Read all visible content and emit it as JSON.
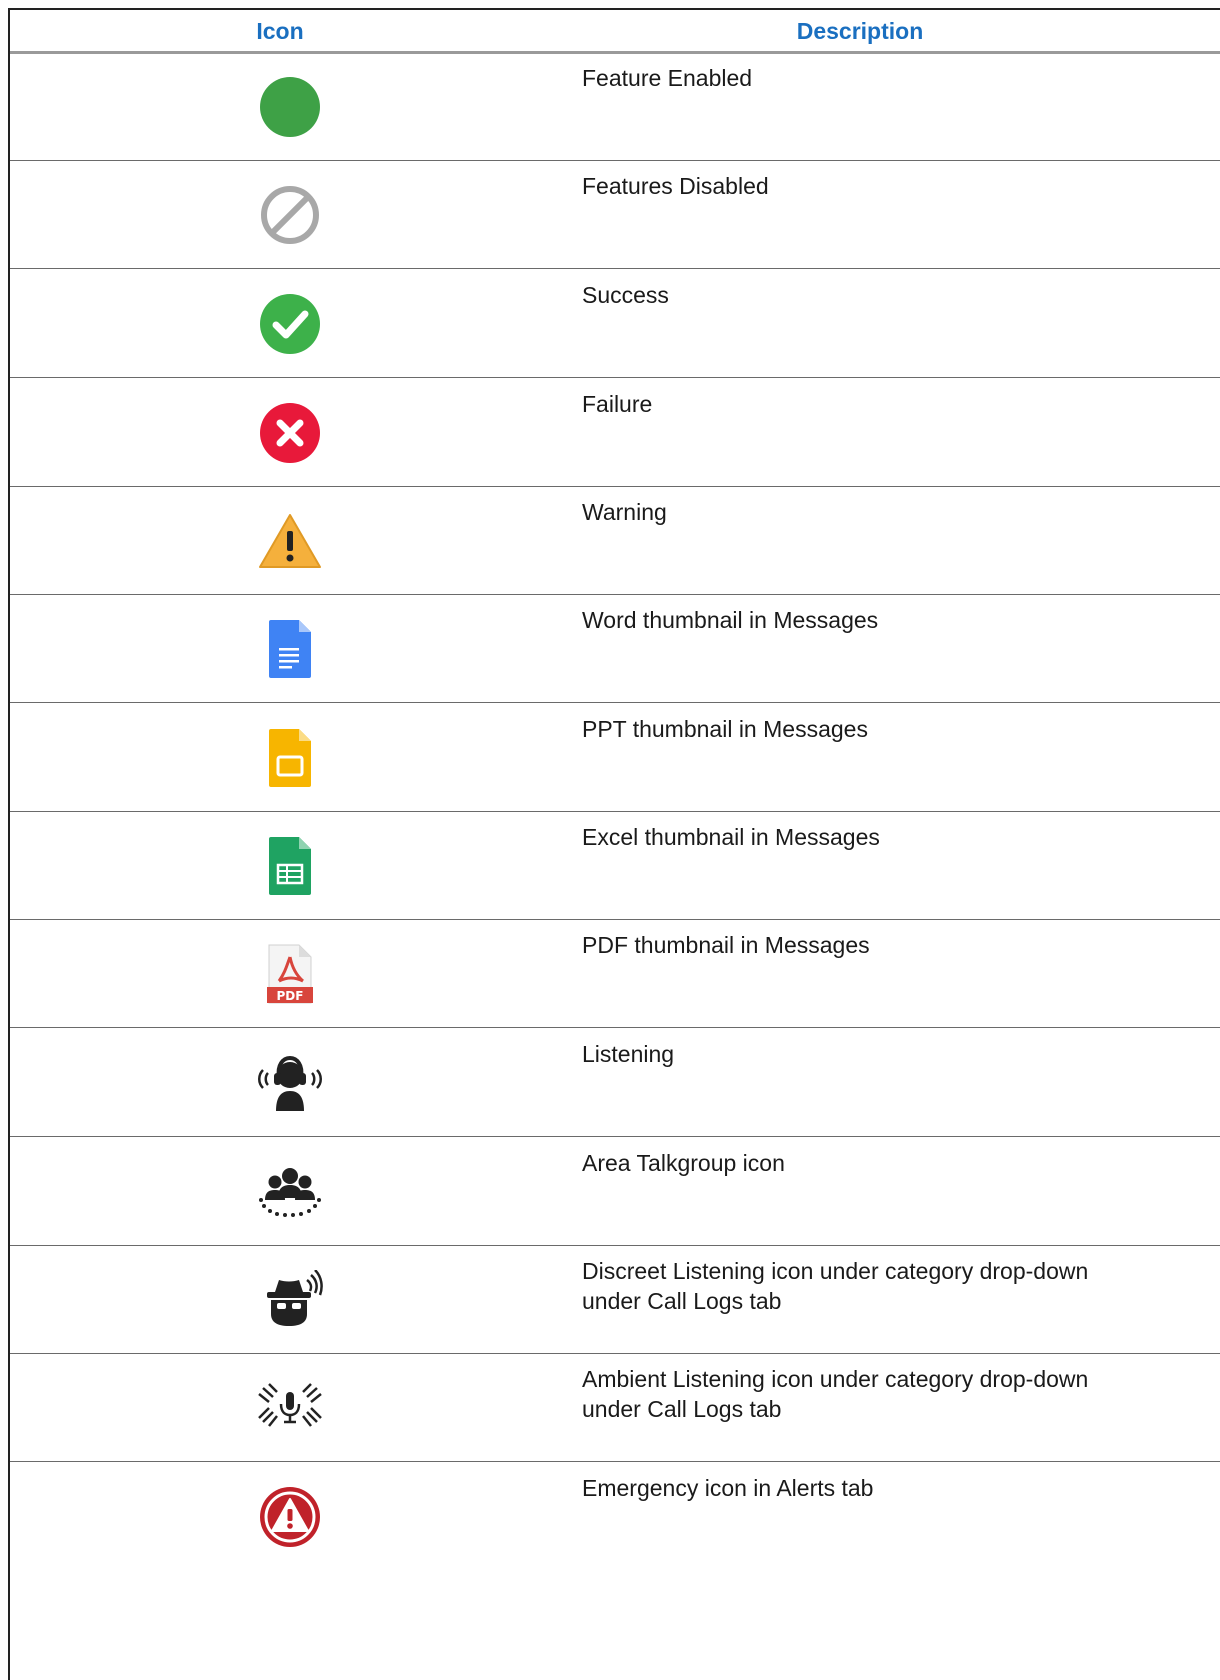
{
  "table": {
    "headers": {
      "icon": "Icon",
      "description": "Description"
    },
    "rows": [
      {
        "icon": "green-circle-icon",
        "description": "Feature Enabled"
      },
      {
        "icon": "disabled-icon",
        "description": "Features Disabled"
      },
      {
        "icon": "success-check-icon",
        "description": "Success"
      },
      {
        "icon": "failure-x-icon",
        "description": "Failure"
      },
      {
        "icon": "warning-triangle-icon",
        "description": "Warning"
      },
      {
        "icon": "word-doc-icon",
        "description": "Word thumbnail in Messages"
      },
      {
        "icon": "ppt-slides-icon",
        "description": "PPT thumbnail in Messages"
      },
      {
        "icon": "excel-sheet-icon",
        "description": "Excel thumbnail in Messages"
      },
      {
        "icon": "pdf-file-icon",
        "description": "PDF thumbnail in Messages"
      },
      {
        "icon": "listening-icon",
        "description": "Listening"
      },
      {
        "icon": "area-talkgroup-icon",
        "description": "Area Talkgroup icon"
      },
      {
        "icon": "discreet-listening-icon",
        "description": "Discreet Listening icon under category drop-down under Call Logs tab"
      },
      {
        "icon": "ambient-listening-icon",
        "description": "Ambient Listening icon under category drop-down under Call Logs tab"
      },
      {
        "icon": "emergency-icon",
        "description": "Emergency icon in Alerts tab"
      }
    ]
  },
  "colors": {
    "header_text": "#1a6fc0",
    "enabled_green": "#3ea146",
    "success_green": "#3db14a",
    "failure_red": "#e8193a",
    "warning_orange": "#f5b03c",
    "word_blue": "#3f83f4",
    "ppt_yellow": "#f7b500",
    "excel_green": "#1fa362",
    "pdf_red": "#d8453c",
    "emergency_red": "#c0222a"
  }
}
